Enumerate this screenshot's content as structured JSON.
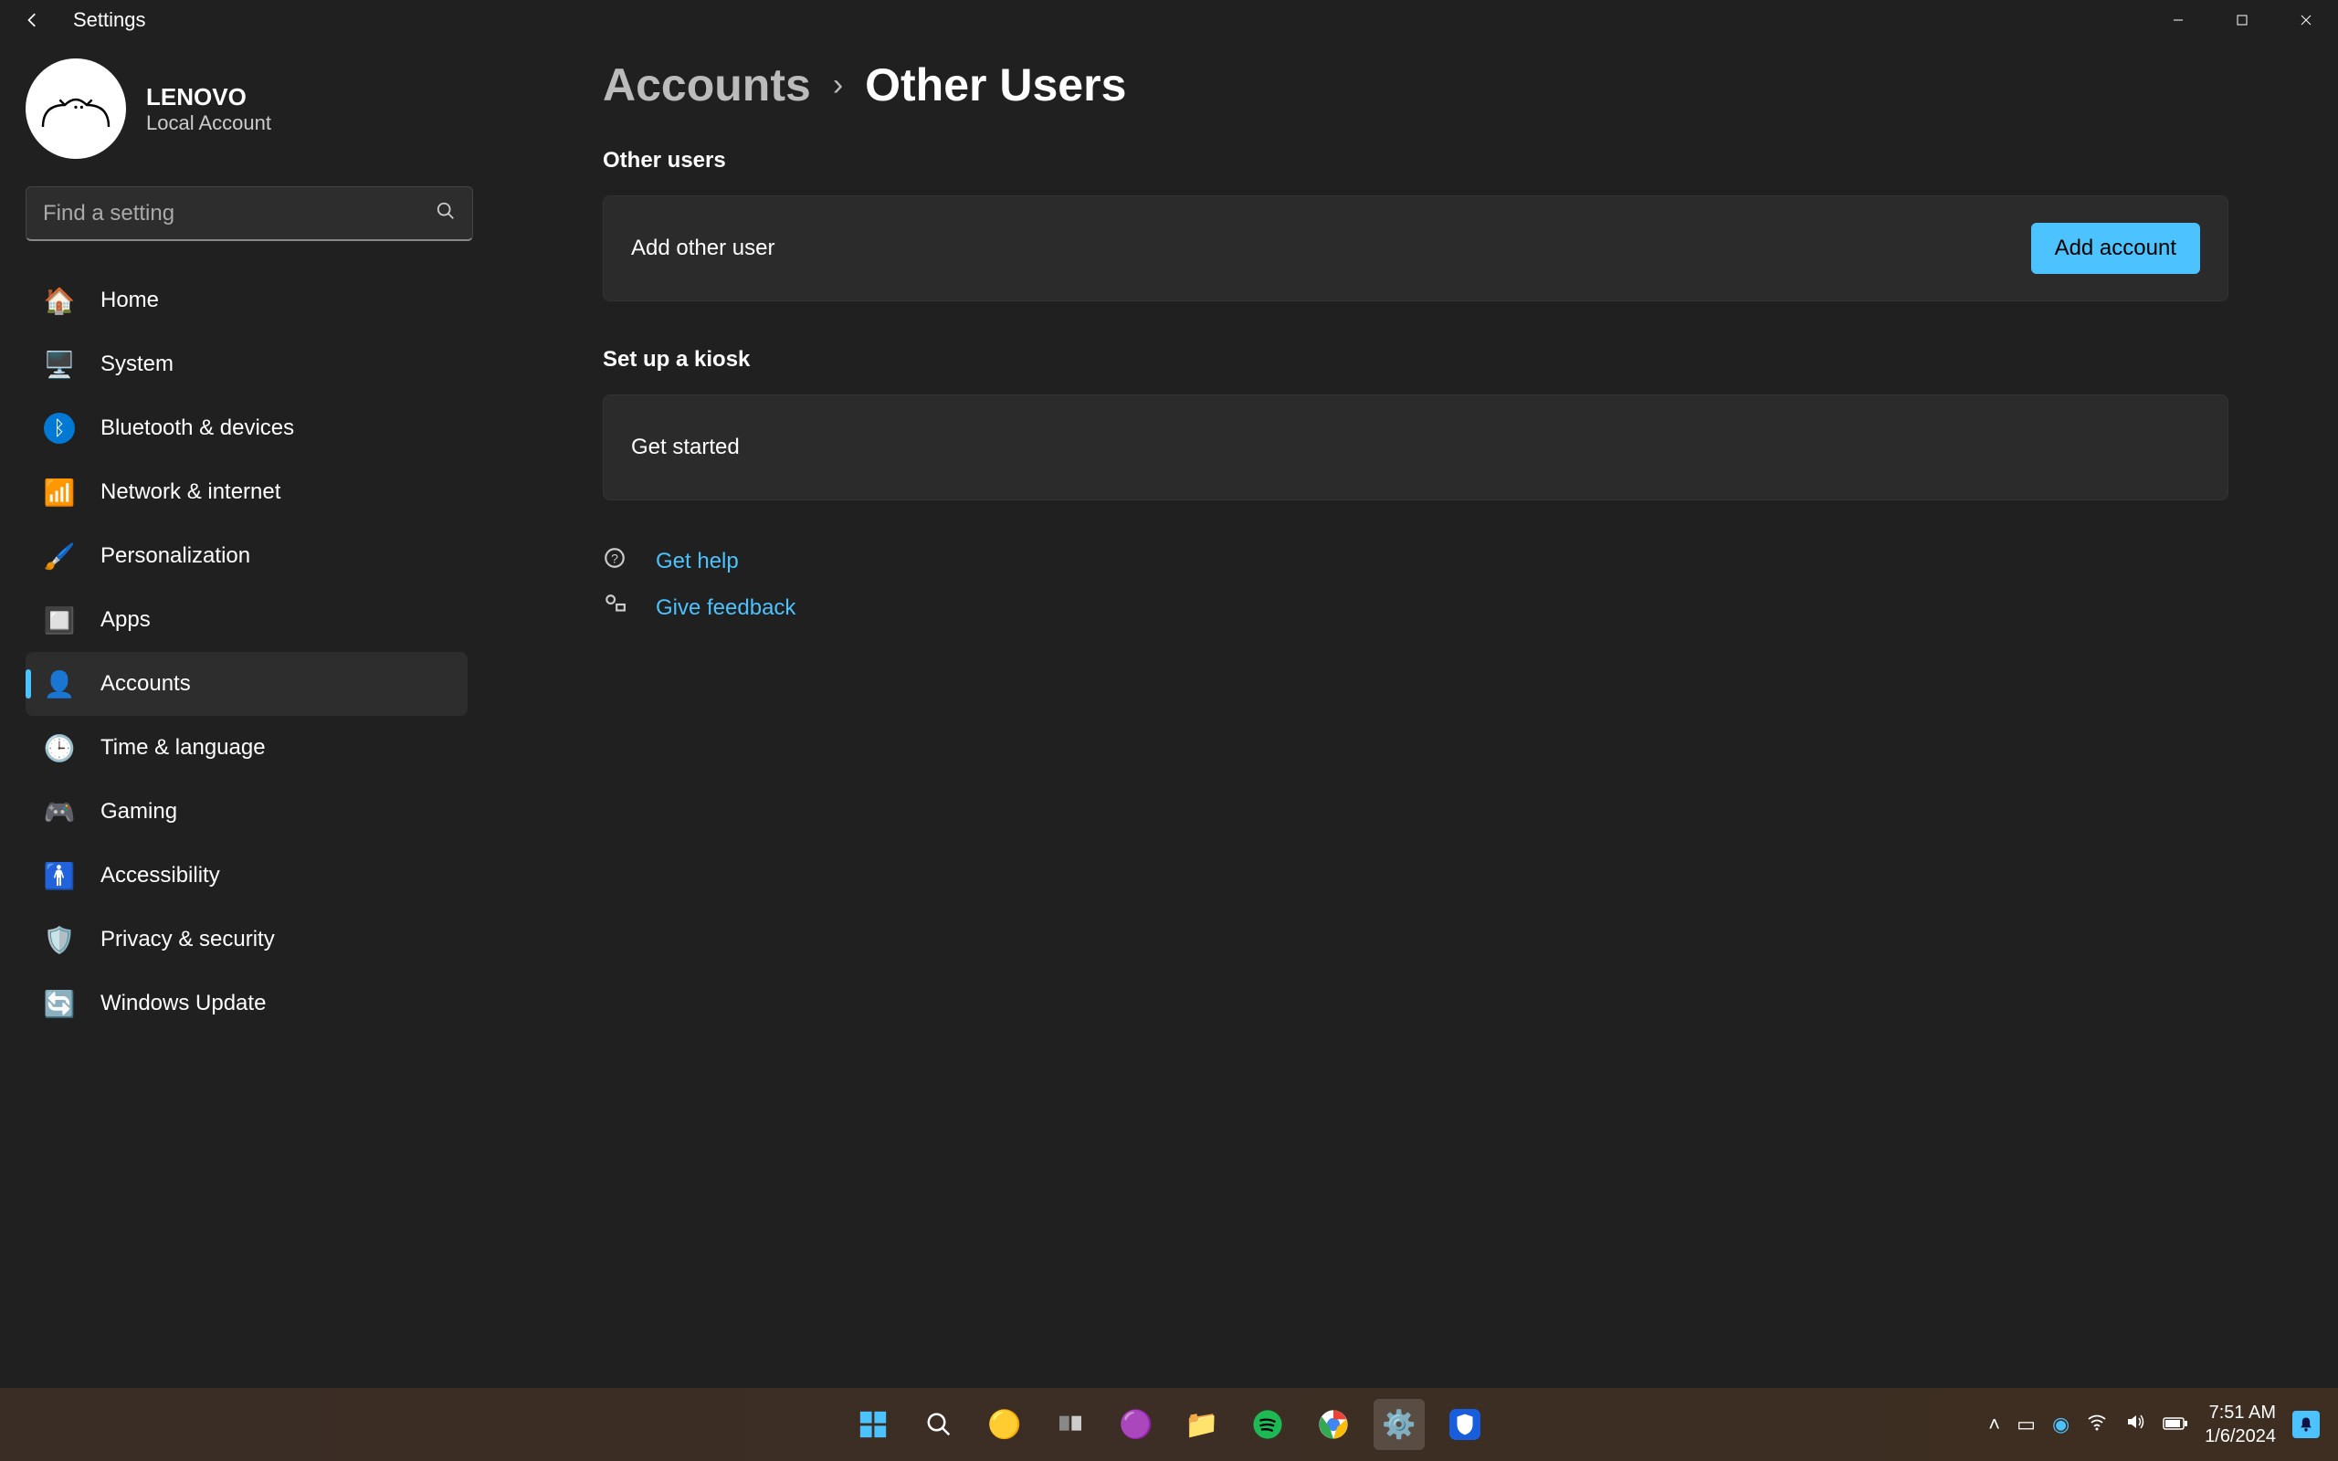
{
  "titlebar": {
    "app_title": "Settings"
  },
  "user": {
    "name": "LENOVO",
    "type": "Local Account"
  },
  "search": {
    "placeholder": "Find a setting"
  },
  "nav": {
    "items": [
      {
        "label": "Home",
        "icon": "🏠"
      },
      {
        "label": "System",
        "icon": "🖥️"
      },
      {
        "label": "Bluetooth & devices",
        "icon": "ᛒ"
      },
      {
        "label": "Network & internet",
        "icon": "📶"
      },
      {
        "label": "Personalization",
        "icon": "🖌️"
      },
      {
        "label": "Apps",
        "icon": "🔲"
      },
      {
        "label": "Accounts",
        "icon": "👤",
        "active": true
      },
      {
        "label": "Time & language",
        "icon": "🕒"
      },
      {
        "label": "Gaming",
        "icon": "🎮"
      },
      {
        "label": "Accessibility",
        "icon": "🚹"
      },
      {
        "label": "Privacy & security",
        "icon": "🛡️"
      },
      {
        "label": "Windows Update",
        "icon": "🔄"
      }
    ]
  },
  "breadcrumb": {
    "parent": "Accounts",
    "sep": "›",
    "current": "Other Users"
  },
  "sections": {
    "other_users": {
      "title": "Other users",
      "add_label": "Add other user",
      "add_button": "Add account"
    },
    "kiosk": {
      "title": "Set up a kiosk",
      "get_started": "Get started"
    }
  },
  "links": {
    "help": "Get help",
    "feedback": "Give feedback"
  },
  "taskbar": {
    "time": "7:51 AM",
    "date": "1/6/2024"
  },
  "colors": {
    "accent": "#4cc2ff",
    "bg": "#202020",
    "card": "#2b2b2b"
  }
}
